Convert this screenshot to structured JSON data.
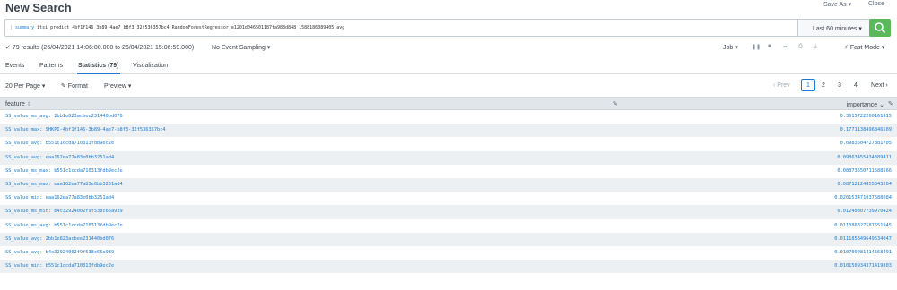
{
  "header": {
    "title": "New Search",
    "save_as": "Save As ▾",
    "close": "Close"
  },
  "search": {
    "query_prefix": "|",
    "query_command": "summary",
    "query_args": "itsi_predict_4bf1f146_3b89_4ae7_b8f3_32f536357bc4_RandomForestRegressor_e1201d046501187fa988d848_1588186089405_avg",
    "time_range": "Last 60 minutes ▾",
    "search_icon": "magnifier-icon"
  },
  "status": {
    "results": "✓ 79 results (26/04/2021 14:06:00.000 to 26/04/2021 15:06:59.000)",
    "sampling": "No Event Sampling ▾",
    "job": "Job ▾",
    "icons": [
      "pause-icon",
      "stop-icon",
      "share-icon",
      "print-icon",
      "export-icon"
    ],
    "fast_mode": "⚡ Fast Mode ▾"
  },
  "tabs": [
    {
      "label": "Events"
    },
    {
      "label": "Patterns"
    },
    {
      "label": "Statistics (79)",
      "active": true
    },
    {
      "label": "Visualization"
    }
  ],
  "toolbar": {
    "per_page": "20 Per Page ▾",
    "format": "✎ Format",
    "preview": "Preview ▾"
  },
  "pagination": {
    "prev": "‹ Prev",
    "pages": [
      "1",
      "2",
      "3",
      "4"
    ],
    "current": "1",
    "next": "Next ›"
  },
  "table": {
    "columns": {
      "feature": "feature",
      "feature_sort": "⇕",
      "importance": "importance ⌄"
    },
    "rows": [
      {
        "feature": "SS_value_ms_avg: 2bb1e823acbee231440bd076",
        "importance": "0.3615722260161915"
      },
      {
        "feature": "SS_value_max: SHKPI-4bf1f146-3b89-4ae7-b8f3-32f536357bc4",
        "importance": "0.1771138496846509"
      },
      {
        "feature": "SS_value_avg: b551c1ccda710313fdb9ec2e",
        "importance": "0.0983504727881705"
      },
      {
        "feature": "SS_value_avg: eaa162ea77a83e0bb3251ad4",
        "importance": "0.09863455434389411"
      },
      {
        "feature": "SS_value_ms_max: b551c1ccda710313fdb9ec2e",
        "importance": "0.08873550711588566"
      },
      {
        "feature": "SS_value_ms_max: eaa162ea77a83e0bb3251ad4",
        "importance": "0.08712124855343204"
      },
      {
        "feature": "SS_value_min: eaa162ea77a83e0bb3251ad4",
        "importance": "0.020153471037688084"
      },
      {
        "feature": "SS_value_ms_min: b4c32924002f9f538c65a939",
        "importance": "0.01240807739970424"
      },
      {
        "feature": "SS_value_ms_avg: b551c1ccda710313fdb9ec2e",
        "importance": "0.011386327587551945"
      },
      {
        "feature": "SS_value_avg: 2bb1e823acbee231440bd076",
        "importance": "0.011185349649634047"
      },
      {
        "feature": "SS_value_avg: b4c32924002f9f538c65a939",
        "importance": "0.010709081414668491"
      },
      {
        "feature": "SS_value_min: b551c1ccda710313fdb9ec2e",
        "importance": "0.010150934371419803"
      }
    ]
  }
}
